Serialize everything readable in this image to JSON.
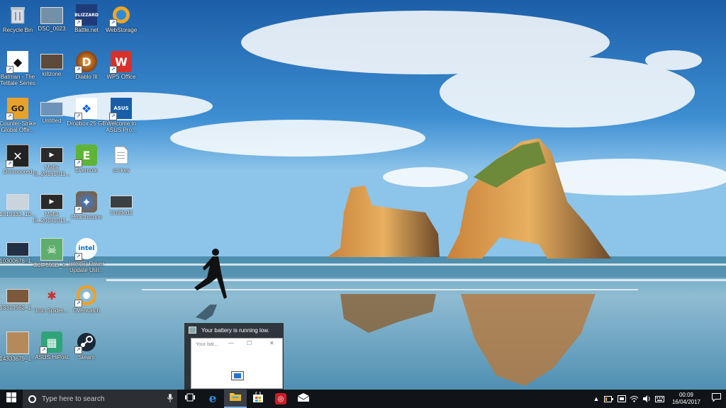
{
  "desktop": {
    "icons": [
      {
        "label": "Recycle Bin",
        "icon": "recycle-bin-icon"
      },
      {
        "label": "DSC_0023",
        "icon": "image-file-icon"
      },
      {
        "label": "Battle.net",
        "icon": "battlenet-icon"
      },
      {
        "label": "WebStorage",
        "icon": "webstorage-icon"
      },
      {
        "label": "Batman - The Telltale Series",
        "icon": "batman-icon"
      },
      {
        "label": "killzone",
        "icon": "image-file-icon"
      },
      {
        "label": "Diablo III",
        "icon": "diablo-icon"
      },
      {
        "label": "WPS Office",
        "icon": "wps-office-icon"
      },
      {
        "label": "Counter-Strike Global Offe...",
        "icon": "csgo-icon"
      },
      {
        "label": "Untitled",
        "icon": "image-file-icon"
      },
      {
        "label": "Dropbox 25 GB",
        "icon": "dropbox-icon"
      },
      {
        "label": "Welcome to ASUS Pro...",
        "icon": "asus-icon"
      },
      {
        "label": "Dishonored",
        "icon": "dishonored-icon"
      },
      {
        "label": "Mafia III_20161011...",
        "icon": "video-file-icon"
      },
      {
        "label": "Evernote",
        "icon": "evernote-icon"
      },
      {
        "label": "cd-key",
        "icon": "text-file-icon"
      },
      {
        "label": "1313333_10...",
        "icon": "image-file-icon"
      },
      {
        "label": "Mafia III_20161011...",
        "icon": "video-file-icon"
      },
      {
        "label": "Hearthstone",
        "icon": "hearthstone-icon"
      },
      {
        "label": "Untitled2",
        "icon": "image-file-icon"
      },
      {
        "label": "10300678_1...",
        "icon": "image-file-icon"
      },
      {
        "label": "C0fF590D_9...",
        "icon": "image-file-icon"
      },
      {
        "label": "Intel(R) Driver Update Utili...",
        "icon": "intel-icon"
      },
      {
        "label": "13313562_1...",
        "icon": "image-file-icon"
      },
      {
        "label": "Iron Spider...",
        "icon": "image-file-icon"
      },
      {
        "label": "Overwatch",
        "icon": "overwatch-icon"
      },
      {
        "label": "14333679_1...",
        "icon": "image-file-icon"
      },
      {
        "label": "ASUS HiPost",
        "icon": "asus-hipost-icon"
      },
      {
        "label": "Steam",
        "icon": "steam-icon"
      }
    ]
  },
  "popup": {
    "title": "Your battery is running low.",
    "thumb_title": "Your bat..."
  },
  "taskbar": {
    "search_placeholder": "Type here to search",
    "clock_time": "00:09",
    "clock_date": "16/04/2017"
  },
  "colors": {
    "taskbar_bg": "#101418",
    "accent": "#7fb2e5"
  }
}
